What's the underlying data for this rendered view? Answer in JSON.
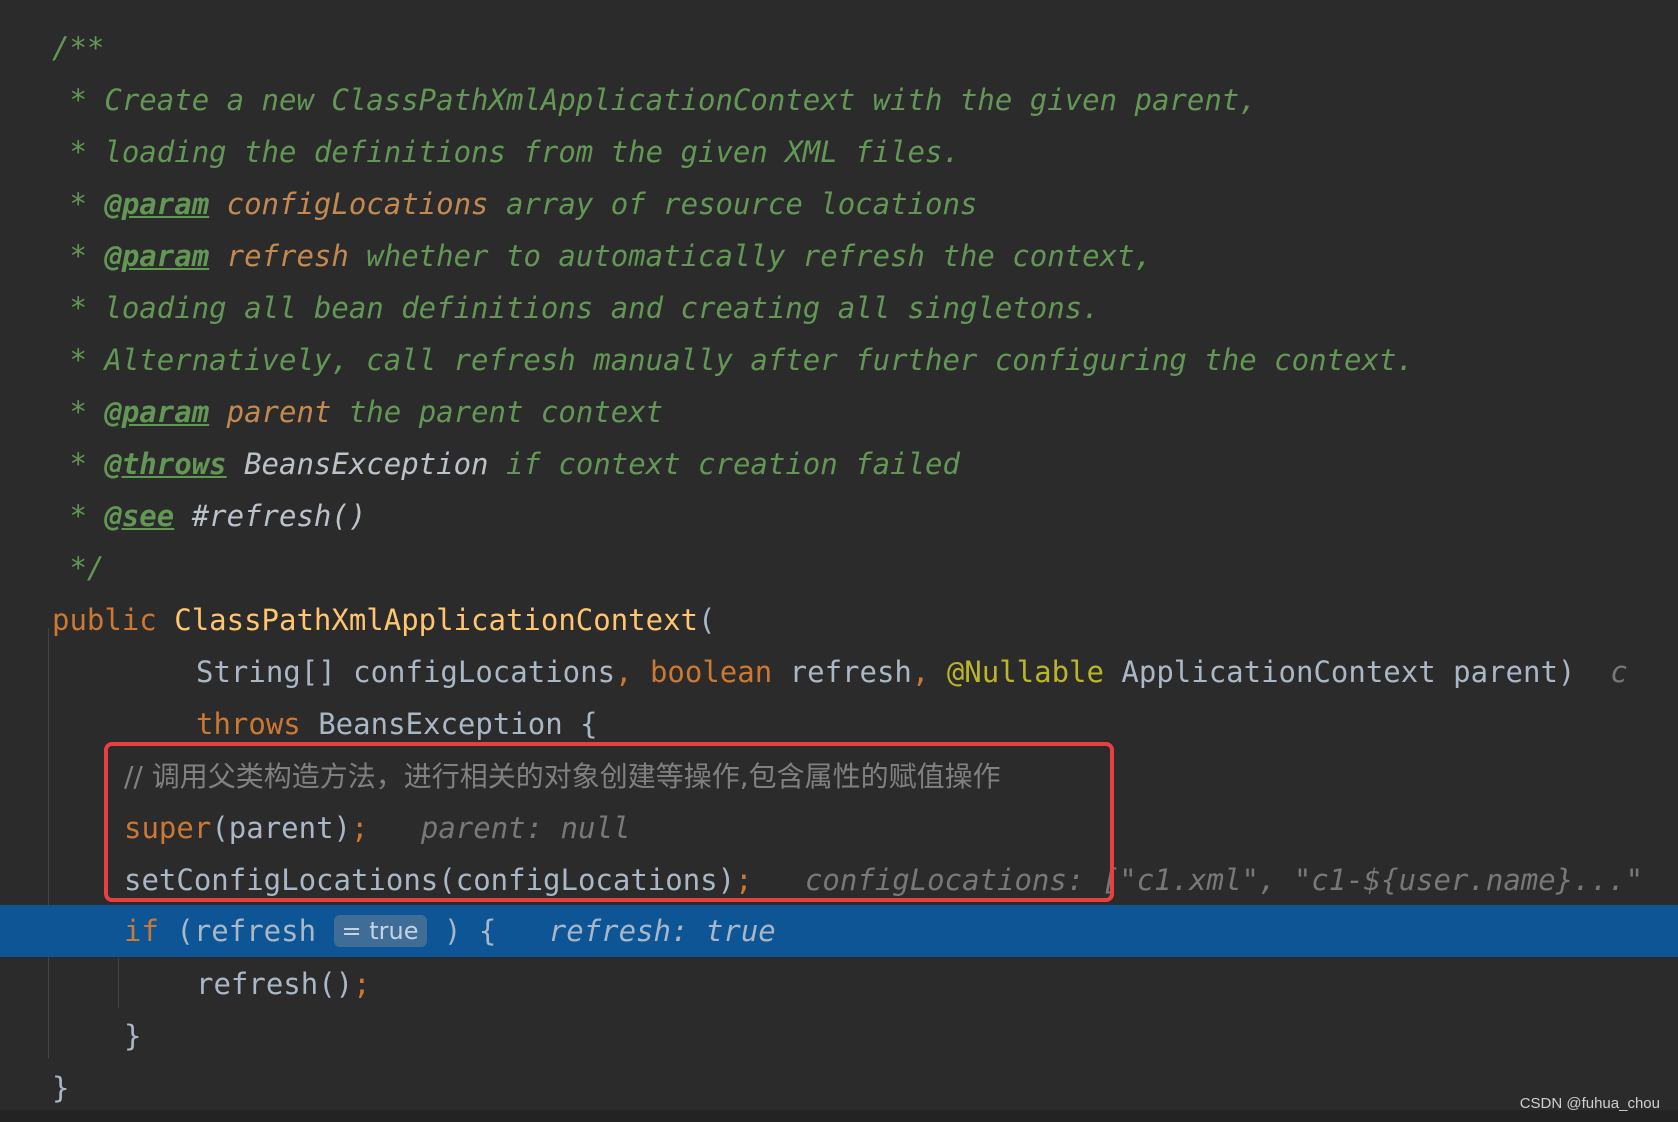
{
  "javadoc": {
    "open": "/**",
    "l1_star": " * ",
    "l1_text": "Create a new ClassPathXmlApplicationContext with the given parent,",
    "l2_text": "loading the definitions from the given XML files.",
    "l3_tag": "@param",
    "l3_param": "configLocations",
    "l3_text": " array of resource locations",
    "l4_tag": "@param",
    "l4_param": "refresh",
    "l4_text": " whether to automatically refresh the context,",
    "l5_text": "loading all bean definitions and creating all singletons.",
    "l6_text": "Alternatively, call refresh manually after further configuring the context.",
    "l7_tag": "@param",
    "l7_param": "parent",
    "l7_text": " the parent context",
    "l8_tag": "@throws",
    "l8_ref": "BeansException",
    "l8_text": " if context creation failed",
    "l9_tag": "@see",
    "l9_ref": "#refresh()",
    "close": " */"
  },
  "code": {
    "public_kw": "public",
    "ctor_name": "ClassPathXmlApplicationContext",
    "paren_open": "(",
    "p1_type": "String[] configLocations",
    "comma1": ",",
    "p2_type": "boolean",
    "p2_name": " refresh",
    "comma2": ",",
    "p3_anno": "@Nullable",
    "p3_rest": " ApplicationContext parent)",
    "p3_trunc": "c",
    "throws_kw": "throws",
    "throws_rest": " BeansException {",
    "comment": "// 调用父类构造方法，进行相关的对象创建等操作,包含属性的赋值操作",
    "super_kw": "super",
    "super_args": "(parent)",
    "semi": ";",
    "super_hint": "parent: null",
    "setcfg_call": "setConfigLocations(configLocations)",
    "setcfg_hint_label": "configLocations:",
    "setcfg_hint_value": "[\"c1.xml\", \"c1-${user.name}...\"",
    "if_kw": "if",
    "if_open": " (refresh",
    "if_inline_value": "= true",
    "if_close": ") {",
    "if_hint": "refresh: true",
    "refresh_call": "refresh()",
    "close_if": "}",
    "close_method": "}"
  },
  "watermark": "CSDN @fuhua_chou",
  "colors": {
    "background": "#2b2b2b",
    "doc_comment": "#629755",
    "keyword": "#cc7832",
    "method": "#ffc66d",
    "annotation": "#bbb529",
    "highlight_line": "#0d5595",
    "red_box": "#e8403f"
  }
}
